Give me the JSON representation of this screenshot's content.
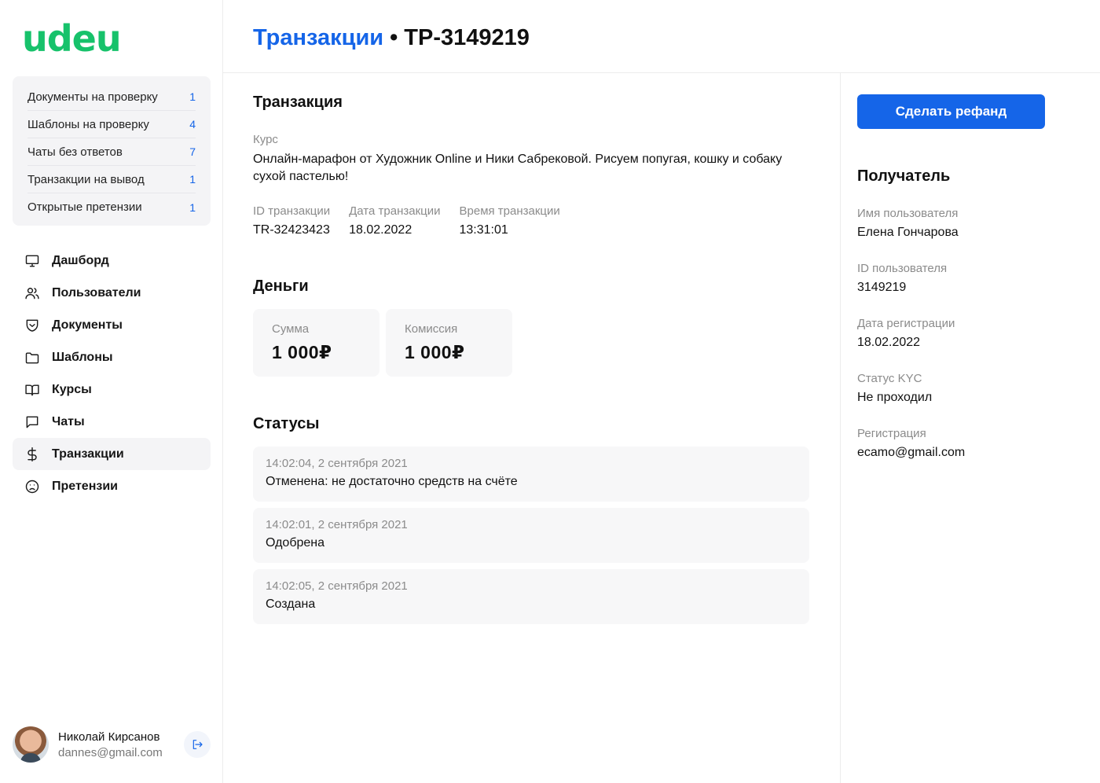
{
  "app": {
    "logo": "udeu"
  },
  "sidebar": {
    "todo": [
      {
        "label": "Документы на проверку",
        "count": "1"
      },
      {
        "label": "Шаблоны на проверку",
        "count": "4"
      },
      {
        "label": "Чаты без ответов",
        "count": "7"
      },
      {
        "label": "Транзакции на вывод",
        "count": "1"
      },
      {
        "label": "Открытые претензии",
        "count": "1"
      }
    ],
    "nav": [
      {
        "label": "Дашборд",
        "icon": "monitor-icon",
        "active": false
      },
      {
        "label": "Пользователи",
        "icon": "users-icon",
        "active": false
      },
      {
        "label": "Документы",
        "icon": "shield-icon",
        "active": false
      },
      {
        "label": "Шаблоны",
        "icon": "folder-icon",
        "active": false
      },
      {
        "label": "Курсы",
        "icon": "book-icon",
        "active": false
      },
      {
        "label": "Чаты",
        "icon": "chat-icon",
        "active": false
      },
      {
        "label": "Транзакции",
        "icon": "dollar-icon",
        "active": true
      },
      {
        "label": "Претензии",
        "icon": "frown-icon",
        "active": false
      }
    ],
    "user": {
      "name": "Николай Кирсанов",
      "email": "dannes@gmail.com"
    }
  },
  "header": {
    "breadcrumb_link": "Транзакции",
    "separator": "•",
    "current": "TP-3149219"
  },
  "transaction": {
    "section_title": "Транзакция",
    "course_label": "Курс",
    "course_value": "Онлайн-марафон от Художник Online и Ники Сабрековой. Рисуем попугая, кошку и собаку сухой пастелью!",
    "id_label": "ID транзакции",
    "id_value": "TR-32423423",
    "date_label": "Дата транзакции",
    "date_value": "18.02.2022",
    "time_label": "Время транзакции",
    "time_value": "13:31:01"
  },
  "money": {
    "section_title": "Деньги",
    "sum_label": "Сумма",
    "sum_value": "1 000₽",
    "fee_label": "Комиссия",
    "fee_value": "1 000₽"
  },
  "statuses": {
    "section_title": "Статусы",
    "items": [
      {
        "time": "14:02:04, 2 сентября 2021",
        "text": "Отменена: не достаточно средств на счёте"
      },
      {
        "time": "14:02:01, 2 сентября 2021",
        "text": "Одобрена"
      },
      {
        "time": "14:02:05, 2 сентября 2021",
        "text": "Создана"
      }
    ]
  },
  "side": {
    "refund_button": "Сделать рефанд",
    "recipient_title": "Получатель",
    "fields": [
      {
        "label": "Имя пользователя",
        "value": "Елена Гончарова"
      },
      {
        "label": "ID пользователя",
        "value": "3149219"
      },
      {
        "label": "Дата регистрации",
        "value": "18.02.2022"
      },
      {
        "label": "Статус KYC",
        "value": "Не проходил"
      },
      {
        "label": "Регистрация",
        "value": "ecamo@gmail.com"
      }
    ]
  },
  "colors": {
    "accent": "#1565e8",
    "brand": "#17c26b",
    "card_bg": "#f7f7f8"
  }
}
